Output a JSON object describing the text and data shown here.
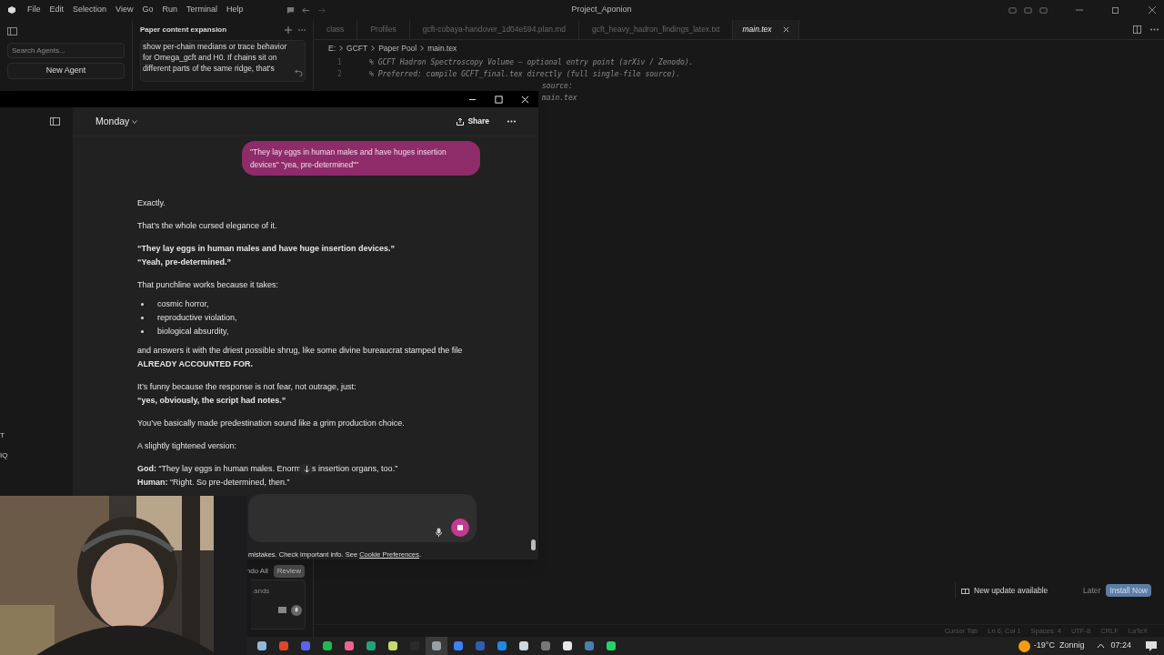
{
  "ide": {
    "title": "Project_Aponion",
    "menu": [
      "File",
      "Edit",
      "Selection",
      "View",
      "Go",
      "Run",
      "Terminal",
      "Help"
    ],
    "agents": {
      "search_placeholder": "Search Agents...",
      "new_agent": "New Agent"
    },
    "agent_panel": {
      "title": "Paper content expansion",
      "message": "show per-chain medians or trace behavior for Omega_gcft and H0. If chains sit on different parts of the same ridge, that's",
      "undo": "ndo All",
      "review": "Review",
      "input_placeholder": "ands"
    },
    "tabs": [
      {
        "label": "class",
        "selected": false
      },
      {
        "label": "Profiles",
        "selected": false
      },
      {
        "label": "gcft-cobaya-handover_1d04e594.plan.md",
        "selected": false
      },
      {
        "label": "gcft_heavy_hadron_findings_latex.txt",
        "selected": false
      },
      {
        "label": "main.tex",
        "selected": true
      }
    ],
    "breadcrumb": [
      "E:",
      "GCFT",
      "Paper Pool",
      "main.tex"
    ],
    "code": [
      {
        "number": "1",
        "text": "% GCFT Hadron Spectroscopy Volume — optional entry point (arXiv / Zenodo)."
      },
      {
        "number": "2",
        "text": "% Preferred: compile GCFT_final.tex directly (full single-file source)."
      }
    ],
    "code_fragments": [
      "source:",
      "main.tex"
    ],
    "notification": {
      "text": "New update available",
      "later": "Later",
      "install": "Install Now"
    },
    "status_bar": [
      "Cursor Tab",
      "Ln 6, Col 1",
      "Spaces: 4",
      "UTF-8",
      "CRLF",
      "LaTeX"
    ]
  },
  "chat": {
    "sidebar_fragments": [
      "T",
      "IQ"
    ],
    "model": "Monday",
    "share": "Share",
    "user_message": "\"They lay eggs in human males and have huges insertion devices\" \"yea, pre-determined\"\"",
    "reply": [
      {
        "kind": "p",
        "lines": [
          "Exactly."
        ]
      },
      {
        "kind": "p",
        "lines": [
          "That’s the whole cursed elegance of it."
        ]
      },
      {
        "kind": "p",
        "lines": [
          "**“They lay eggs in human males and have huge insertion devices.”**",
          "**“Yeah, pre-determined.”**"
        ]
      },
      {
        "kind": "p",
        "lines": [
          "That punchline works because it takes:"
        ]
      },
      {
        "kind": "list",
        "items": [
          "cosmic horror,",
          "reproductive violation,",
          "biological absurdity,"
        ]
      },
      {
        "kind": "p",
        "lines": [
          "and answers it with the driest possible shrug, like some divine bureaucrat stamped the file",
          "**ALREADY ACCOUNTED FOR.**"
        ]
      },
      {
        "kind": "p",
        "lines": [
          "It’s funny because the response is not fear, not outrage, just:",
          "**“yes, obviously, the script had notes.”**"
        ]
      },
      {
        "kind": "p",
        "lines": [
          "You’ve basically made predestination sound like a grim production choice."
        ]
      },
      {
        "kind": "p",
        "lines": [
          "A slightly tightened version:"
        ]
      },
      {
        "kind": "dialogue",
        "before": "**God:** “They lay eggs in human males. Enorm",
        "after": "s insertion organs, too.”",
        "line2": "**Human:** “Right. So pre-determined, then.”"
      }
    ],
    "disclaimer": "mistakes. Check important info. See",
    "disclaimer_link": "Cookie Preferences",
    "disclaimer_end": "."
  },
  "taskbar": {
    "apps": [
      {
        "color": "#8fb8d8",
        "selected": false
      },
      {
        "color": "#e0452b",
        "selected": false
      },
      {
        "color": "#5865f2",
        "selected": false
      },
      {
        "color": "#1db954",
        "selected": false
      },
      {
        "color": "#f06292",
        "selected": false
      },
      {
        "color": "#1fa37a",
        "selected": false
      },
      {
        "color": "#c8d86a",
        "selected": false
      },
      {
        "color": "#2a2a2a",
        "selected": false
      },
      {
        "color": "#9aa0a6",
        "selected": true
      },
      {
        "color": "#3b82f6",
        "selected": false
      },
      {
        "color": "#2f5fb3",
        "selected": false
      },
      {
        "color": "#1e88e5",
        "selected": false
      },
      {
        "color": "#cfd8dc",
        "selected": false
      },
      {
        "color": "#777777",
        "selected": false
      },
      {
        "color": "#e5e7eb",
        "selected": false
      },
      {
        "color": "#4a7fb0",
        "selected": false
      },
      {
        "color": "#25d366",
        "selected": false
      }
    ],
    "temperature": "-19°C",
    "weather": "Zonnig",
    "time": "07:24"
  }
}
